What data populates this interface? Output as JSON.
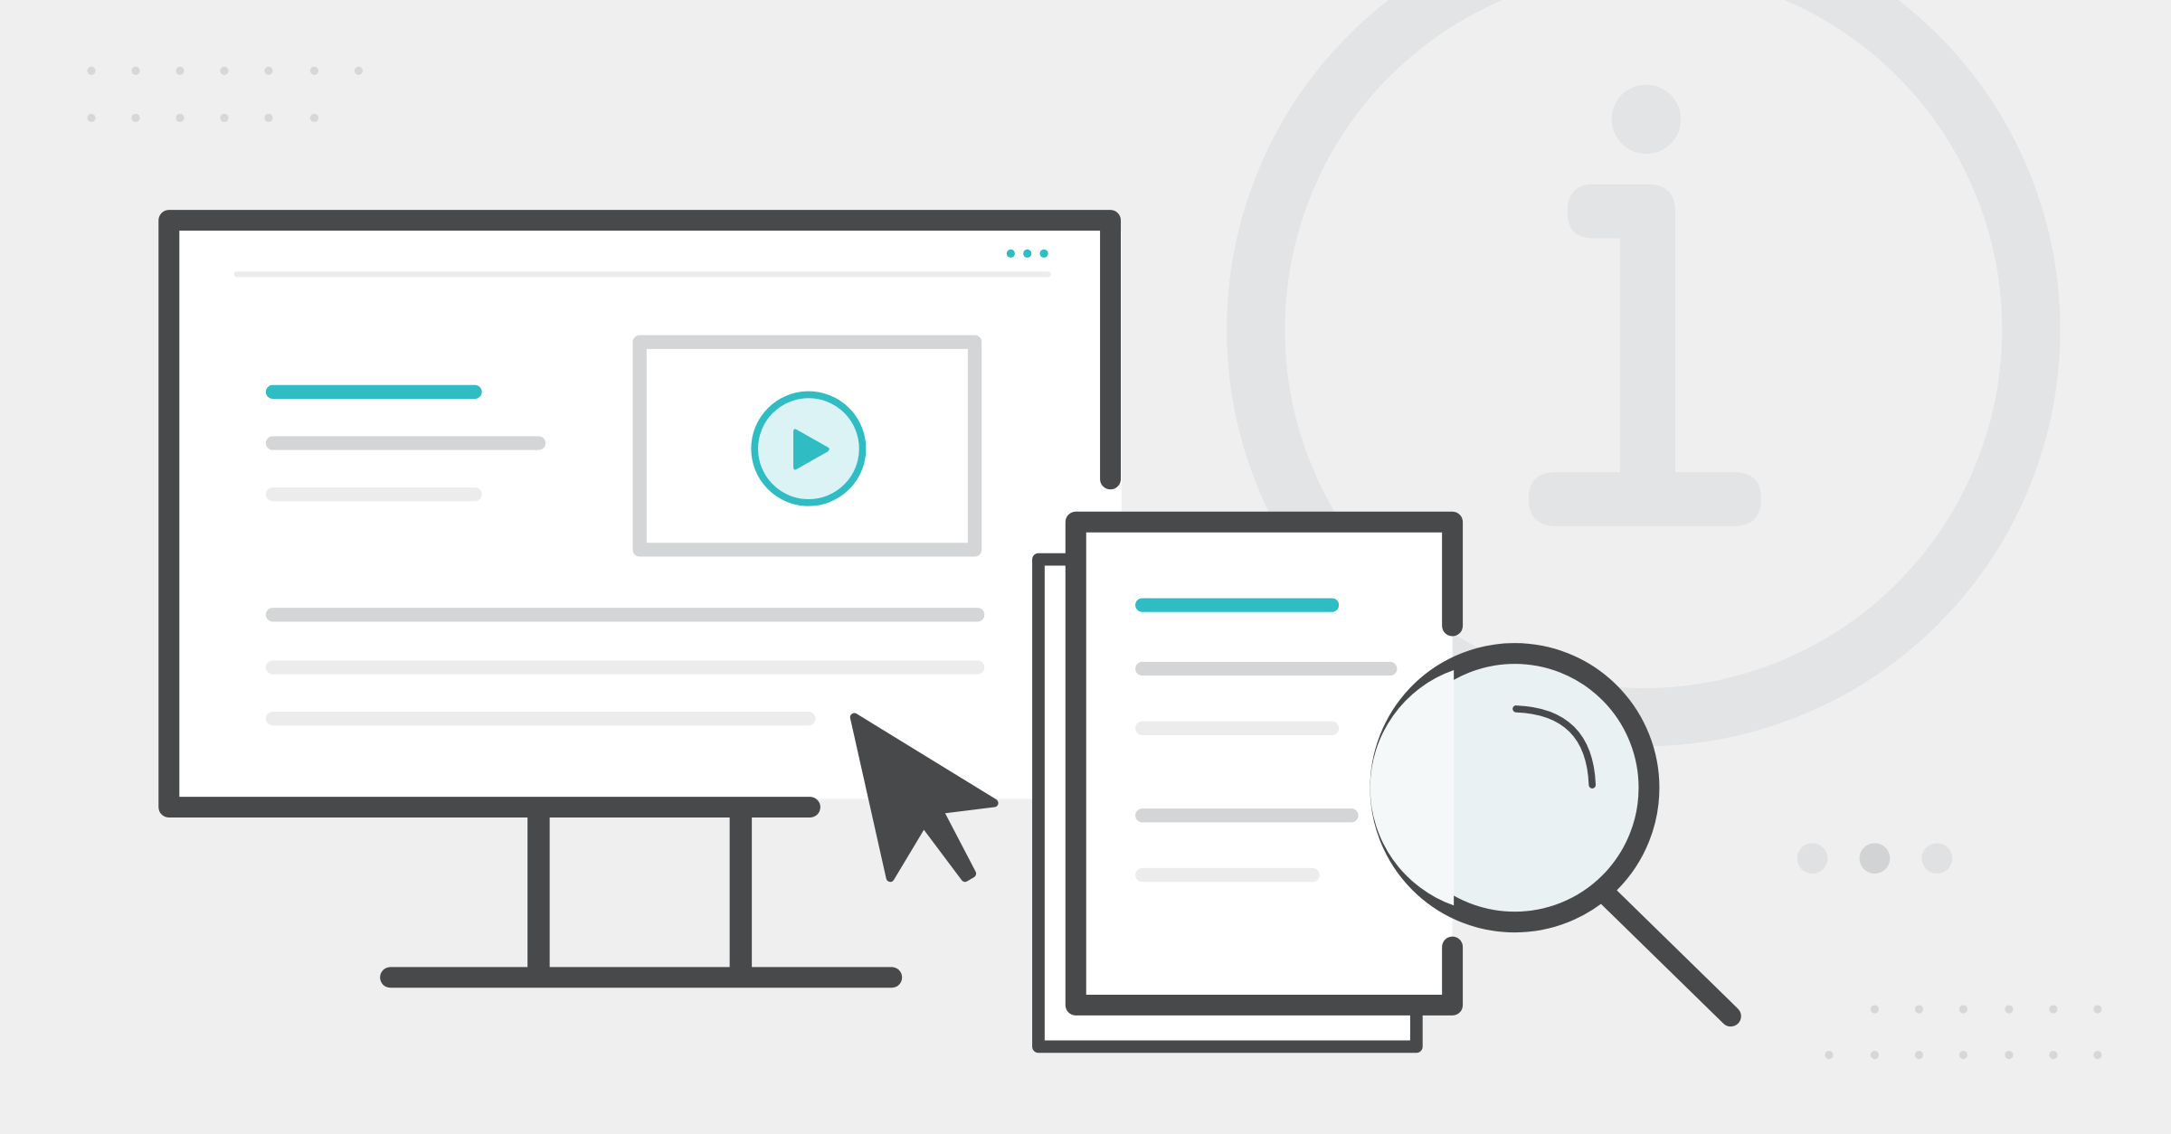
{
  "colors": {
    "background": "#efefef",
    "outline": "#47494b",
    "accent": "#2fbcc3",
    "accent_light": "#dcf3f5",
    "line_gray": "#d4d5d6",
    "line_light": "#e8e9ea",
    "watermark": "#e3e4e5",
    "dot": "#d6d7d8",
    "lens_fill": "#e9f1f2",
    "screen": "#ffffff"
  },
  "icons": {
    "info": "info-icon",
    "play": "play-icon",
    "cursor": "cursor-arrow-icon",
    "magnifier": "magnifying-glass-icon",
    "document": "document-icon",
    "monitor": "monitor-icon",
    "menu": "more-dots-icon"
  }
}
